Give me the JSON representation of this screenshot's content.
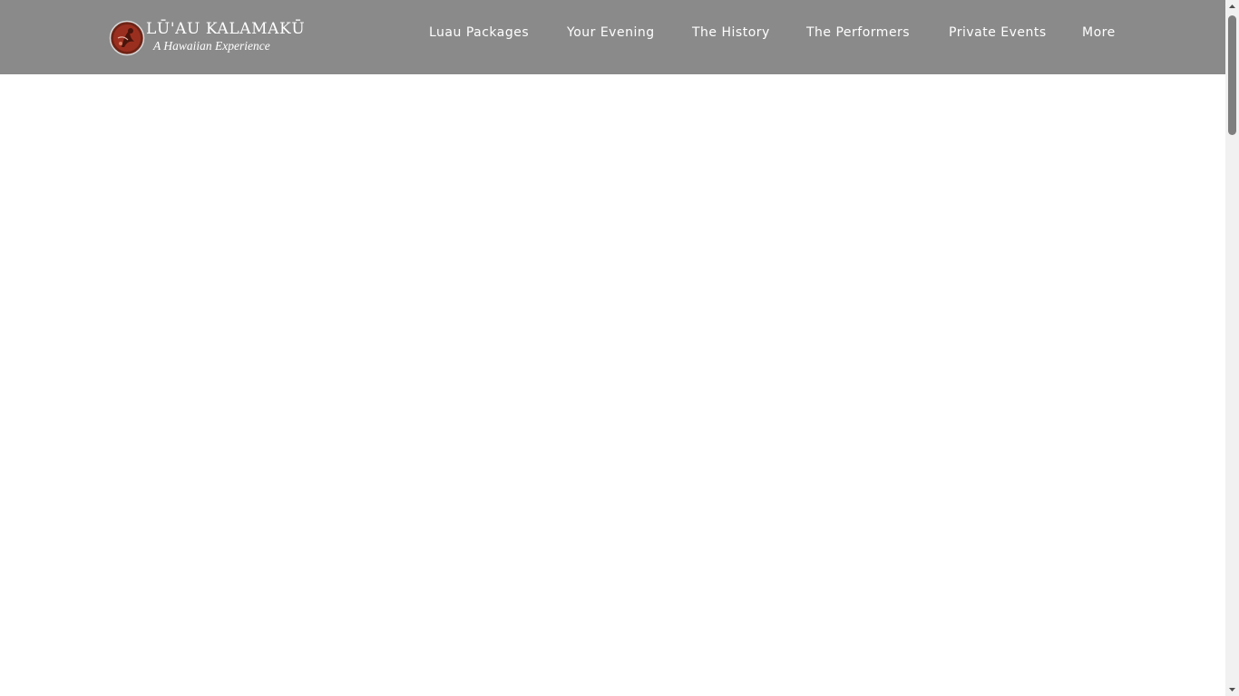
{
  "page": {
    "background": "#ffffff"
  },
  "header": {
    "background": "#8a8a8a",
    "text_color": "#ffffff",
    "logo": {
      "title": "LŪ'AU KALAMAKŪ",
      "subtitle": "A Hawaiian Experience",
      "emblem_icon": "luau-dancer-emblem-icon",
      "emblem_colors": [
        "#7a2a1c",
        "#c0392b",
        "#5a1a10"
      ]
    },
    "nav": {
      "items": [
        {
          "label": "Luau Packages"
        },
        {
          "label": "Your Evening"
        },
        {
          "label": "The History"
        },
        {
          "label": "The Performers"
        },
        {
          "label": "Private Events"
        },
        {
          "label": "More"
        }
      ]
    }
  },
  "scrollbar": {
    "track_color": "#f1f1f1",
    "thumb_color": "#7e7e7e"
  }
}
